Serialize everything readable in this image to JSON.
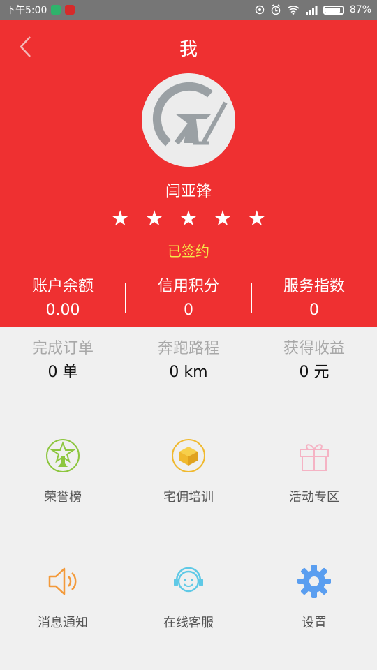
{
  "status_bar": {
    "time": "下午5:00",
    "battery": "87%",
    "battery_level": 0.87
  },
  "header": {
    "title": "我"
  },
  "profile": {
    "name": "闫亚锋",
    "rating": 5,
    "rating_stars": [
      "★",
      "★",
      "★",
      "★",
      "★"
    ],
    "status": "已签约"
  },
  "account": [
    {
      "label": "账户余额",
      "value": "0.00"
    },
    {
      "label": "信用积分",
      "value": "0"
    },
    {
      "label": "服务指数",
      "value": "0"
    }
  ],
  "stats": [
    {
      "label": "完成订单",
      "value": "0 单"
    },
    {
      "label": "奔跑路程",
      "value": "0 km"
    },
    {
      "label": "获得收益",
      "value": "0 元"
    }
  ],
  "menu": [
    {
      "label": "荣誉榜",
      "icon": "honor-trophy-icon"
    },
    {
      "label": "宅佣培训",
      "icon": "training-box-icon"
    },
    {
      "label": "活动专区",
      "icon": "gift-icon"
    },
    {
      "label": "消息通知",
      "icon": "speaker-icon"
    },
    {
      "label": "在线客服",
      "icon": "customer-service-icon"
    },
    {
      "label": "设置",
      "icon": "gear-icon"
    }
  ],
  "colors": {
    "header_red": "#ef3031",
    "signed_yellow": "#f5e84a",
    "background": "#f0f0f0"
  }
}
